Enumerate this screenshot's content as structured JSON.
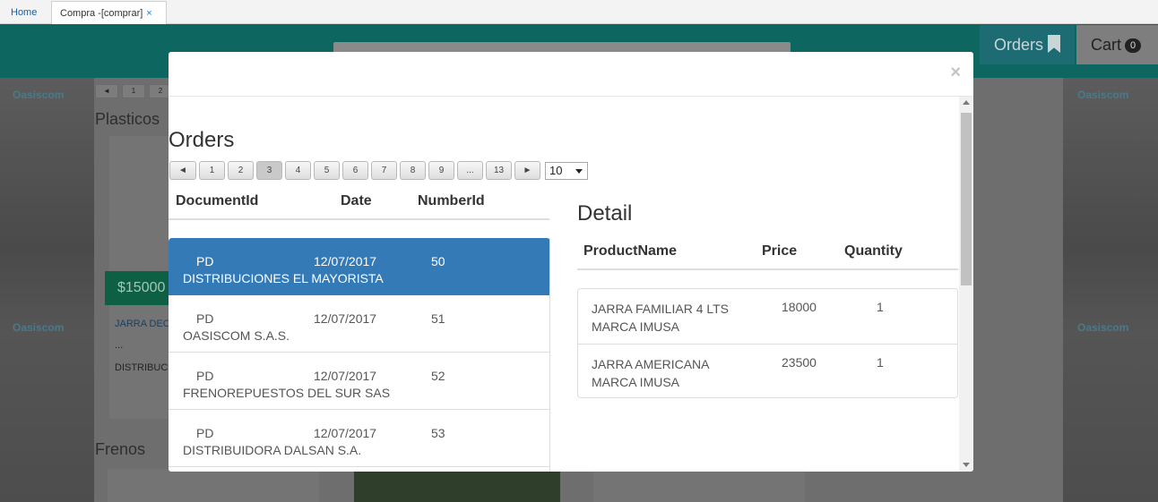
{
  "tabs": [
    {
      "label": "Home"
    },
    {
      "label": "Compra -[comprar]",
      "close": "×"
    }
  ],
  "header": {
    "orders_label": "Orders",
    "cart_label": "Cart",
    "cart_count": "0"
  },
  "background": {
    "brand": "Oasiscom",
    "mini_pager": [
      "◄",
      "1",
      "2"
    ],
    "category_1": "Plasticos",
    "category_2": "Frenos",
    "price": "$15000",
    "product_name": "JARRA DEC",
    "ellipsis": "...",
    "seller": "DISTRIBUC"
  },
  "modal": {
    "close": "×",
    "orders_title": "Orders",
    "pager": {
      "prev": "◄",
      "pages": [
        "1",
        "2",
        "3",
        "4",
        "5",
        "6",
        "7",
        "8",
        "9",
        "...",
        "13"
      ],
      "next": "►",
      "current": "3",
      "page_size": "10"
    },
    "orders_columns": [
      "DocumentId",
      "Date",
      "NumberId"
    ],
    "orders": [
      {
        "doc": "PD",
        "date": "12/07/2017",
        "number": "50",
        "company": "DISTRIBUCIONES EL MAYORISTA",
        "selected": true
      },
      {
        "doc": "PD",
        "date": "12/07/2017",
        "number": "51",
        "company": "OASISCOM S.A.S.",
        "selected": false
      },
      {
        "doc": "PD",
        "date": "12/07/2017",
        "number": "52",
        "company": "FRENOREPUESTOS DEL SUR SAS",
        "selected": false
      },
      {
        "doc": "PD",
        "date": "12/07/2017",
        "number": "53",
        "company": "DISTRIBUIDORA DALSAN S.A.",
        "selected": false
      }
    ],
    "detail_title": "Detail",
    "detail_columns": [
      "ProductName",
      "Price",
      "Quantity"
    ],
    "details": [
      {
        "product": "JARRA FAMILIAR 4 LTS MARCA IMUSA",
        "price": "18000",
        "quantity": "1"
      },
      {
        "product": "JARRA AMERICANA MARCA IMUSA",
        "price": "23500",
        "quantity": "1"
      }
    ]
  },
  "colors": {
    "selected_row": "#337ab7",
    "header_teal": "#0d6660"
  }
}
